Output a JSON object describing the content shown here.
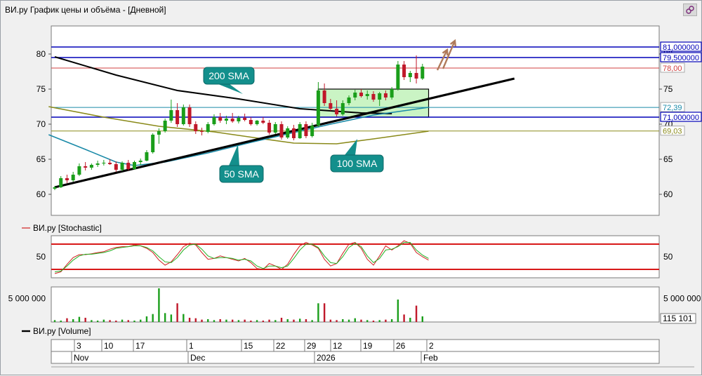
{
  "window": {
    "title": "ВИ.ру График цены и объёма - [Дневной]",
    "corner_icon": "link-icon"
  },
  "chart_data": [
    {
      "type": "candlestick",
      "panel": "price",
      "ylim": [
        57,
        84
      ],
      "y_ticks": [
        60,
        65,
        70,
        75,
        80
      ],
      "grid": false,
      "bar_count": 61,
      "series": [
        {
          "name": "candles",
          "color_up": "#1a9e1a",
          "color_down": "#c0182a",
          "ohlc": [
            [
              60.8,
              61.2,
              60.6,
              61.0
            ],
            [
              61.0,
              62.6,
              60.9,
              62.3
            ],
            [
              62.3,
              62.8,
              61.6,
              62.0
            ],
            [
              62.0,
              63.2,
              61.8,
              62.8
            ],
            [
              62.8,
              64.4,
              62.6,
              64.0
            ],
            [
              64.0,
              64.6,
              63.4,
              63.8
            ],
            [
              63.8,
              64.4,
              63.5,
              64.2
            ],
            [
              64.2,
              64.8,
              63.9,
              64.4
            ],
            [
              64.4,
              64.9,
              64.1,
              64.5
            ],
            [
              64.5,
              65.0,
              64.2,
              64.3
            ],
            [
              64.3,
              64.7,
              63.2,
              63.5
            ],
            [
              63.5,
              64.7,
              63.3,
              64.5
            ],
            [
              64.5,
              64.9,
              63.4,
              63.6
            ],
            [
              63.6,
              64.8,
              63.5,
              64.6
            ],
            [
              64.6,
              65.1,
              64.2,
              64.8
            ],
            [
              64.8,
              66.3,
              64.7,
              66.0
            ],
            [
              66.0,
              68.7,
              65.8,
              68.5
            ],
            [
              68.5,
              69.4,
              67.2,
              69.0
            ],
            [
              69.0,
              70.8,
              68.8,
              70.5
            ],
            [
              70.5,
              73.5,
              70.2,
              72.0
            ],
            [
              72.0,
              73.0,
              69.6,
              70.0
            ],
            [
              70.0,
              72.8,
              69.8,
              72.4
            ],
            [
              72.4,
              72.8,
              69.6,
              70.0
            ],
            [
              70.0,
              70.4,
              68.6,
              69.0
            ],
            [
              69.0,
              69.5,
              68.4,
              68.9
            ],
            [
              68.9,
              70.3,
              68.7,
              70.0
            ],
            [
              70.0,
              71.4,
              69.8,
              71.0
            ],
            [
              71.0,
              71.6,
              70.2,
              70.5
            ],
            [
              70.5,
              71.2,
              70.0,
              70.8
            ],
            [
              70.8,
              71.6,
              70.2,
              70.4
            ],
            [
              70.4,
              71.2,
              70.1,
              70.9
            ],
            [
              70.9,
              71.5,
              70.4,
              70.6
            ],
            [
              70.6,
              71.0,
              69.8,
              70.0
            ],
            [
              70.0,
              70.6,
              69.8,
              70.5
            ],
            [
              70.5,
              71.0,
              70.0,
              70.2
            ],
            [
              70.2,
              70.6,
              68.5,
              68.8
            ],
            [
              68.8,
              70.3,
              68.6,
              70.0
            ],
            [
              70.0,
              70.4,
              67.8,
              68.1
            ],
            [
              68.1,
              69.7,
              67.9,
              69.4
            ],
            [
              69.4,
              69.9,
              67.7,
              68.0
            ],
            [
              68.0,
              70.3,
              67.9,
              70.0
            ],
            [
              70.0,
              70.4,
              68.0,
              68.3
            ],
            [
              68.3,
              70.2,
              68.1,
              69.8
            ],
            [
              69.8,
              76.0,
              69.6,
              74.8
            ],
            [
              74.8,
              75.8,
              72.6,
              73.0
            ],
            [
              73.0,
              73.6,
              71.9,
              72.2
            ],
            [
              72.2,
              73.4,
              71.1,
              71.4
            ],
            [
              71.4,
              73.4,
              71.2,
              73.0
            ],
            [
              73.0,
              74.1,
              72.7,
              73.8
            ],
            [
              73.8,
              74.9,
              73.4,
              74.5
            ],
            [
              74.5,
              75.0,
              73.8,
              74.0
            ],
            [
              74.0,
              74.8,
              73.5,
              74.3
            ],
            [
              74.3,
              74.7,
              73.2,
              73.5
            ],
            [
              73.5,
              74.6,
              72.6,
              74.4
            ],
            [
              74.4,
              74.8,
              73.4,
              73.8
            ],
            [
              73.8,
              75.3,
              73.5,
              75.0
            ],
            [
              75.0,
              79.0,
              74.8,
              78.5
            ],
            [
              78.5,
              79.0,
              76.3,
              76.7
            ],
            [
              76.7,
              77.6,
              76.0,
              77.3
            ],
            [
              77.3,
              79.8,
              75.8,
              76.5
            ],
            [
              76.5,
              78.6,
              76.3,
              78.2
            ]
          ]
        },
        {
          "name": "200 SMA",
          "color": "#000000",
          "points": [
            [
              0,
              79.6
            ],
            [
              10,
              77.0
            ],
            [
              20,
              74.8
            ],
            [
              30,
              73.6
            ],
            [
              40,
              72.2
            ],
            [
              50,
              71.6
            ],
            [
              55,
              71.5
            ]
          ]
        },
        {
          "name": "100 SMA",
          "color": "#8a8a1a",
          "points": [
            [
              -1,
              72.5
            ],
            [
              8,
              71.0
            ],
            [
              17,
              69.7
            ],
            [
              26,
              68.9
            ],
            [
              34,
              67.9
            ],
            [
              39,
              67.3
            ],
            [
              46,
              67.2
            ],
            [
              52,
              67.9
            ],
            [
              61,
              69.0
            ]
          ]
        },
        {
          "name": "50 SMA",
          "color": "#1a8aa8",
          "points": [
            [
              -1,
              68.5
            ],
            [
              5,
              66.4
            ],
            [
              10,
              64.6
            ],
            [
              13,
              64.1
            ],
            [
              18,
              64.6
            ],
            [
              25,
              65.9
            ],
            [
              32,
              67.4
            ],
            [
              38,
              68.6
            ],
            [
              45,
              70.0
            ],
            [
              52,
              71.3
            ],
            [
              61,
              72.4
            ]
          ]
        }
      ],
      "hlines": [
        {
          "value": 81.0,
          "label": "81,000000",
          "color": "#0000b8",
          "style": "label-box"
        },
        {
          "value": 79.5,
          "label": "79,500000",
          "color": "#0000b8",
          "style": "label-box"
        },
        {
          "value": 78.0,
          "label": "78,00",
          "color": "#d04040",
          "style": "thin"
        },
        {
          "value": 72.39,
          "label": "72,39",
          "color": "#1a8aa8",
          "style": "thin"
        },
        {
          "value": 71.0,
          "label": "71,000000",
          "color": "#0000b8",
          "style": "label-box"
        },
        {
          "value": 69.03,
          "label": "69,03",
          "color": "#8a8a1a",
          "style": "thin"
        }
      ],
      "trendline": {
        "from": [
          0.0,
          61.0
        ],
        "to": [
          75.0,
          76.5
        ],
        "color": "#000000"
      },
      "annotations": [
        {
          "text": "200 SMA"
        },
        {
          "text": "50 SMA"
        },
        {
          "text": "100 SMA"
        }
      ],
      "box": {
        "x0": 43,
        "x1": 61,
        "y0": 71.0,
        "y1": 75.0,
        "fill": "#b8f0b0"
      }
    },
    {
      "type": "line",
      "panel": "stochastic",
      "title": "ВИ.ру [Stochastic]",
      "y_ticks": [
        50
      ],
      "levels": [
        80,
        20
      ],
      "series": [
        {
          "name": "%K",
          "color": "#d02020",
          "values": [
            10,
            14,
            32,
            48,
            55,
            55,
            57,
            60,
            62,
            68,
            72,
            74,
            74,
            78,
            76,
            70,
            60,
            42,
            30,
            38,
            55,
            74,
            82,
            78,
            60,
            44,
            46,
            52,
            48,
            44,
            40,
            46,
            36,
            22,
            20,
            34,
            28,
            20,
            32,
            56,
            76,
            84,
            78,
            70,
            44,
            28,
            34,
            58,
            80,
            84,
            70,
            44,
            30,
            52,
            76,
            66,
            76,
            88,
            82,
            60,
            50,
            42
          ]
        },
        {
          "name": "%D",
          "color": "#20b020",
          "values": [
            14,
            16,
            28,
            42,
            52,
            56,
            56,
            58,
            60,
            64,
            70,
            72,
            74,
            76,
            76,
            72,
            64,
            50,
            38,
            36,
            48,
            66,
            78,
            80,
            68,
            52,
            46,
            48,
            48,
            46,
            42,
            44,
            40,
            28,
            22,
            28,
            28,
            24,
            28,
            46,
            66,
            80,
            80,
            72,
            52,
            36,
            34,
            50,
            72,
            82,
            74,
            52,
            36,
            46,
            66,
            68,
            74,
            84,
            84,
            66,
            54,
            46
          ]
        }
      ]
    },
    {
      "type": "bar",
      "panel": "volume",
      "title": "ВИ.ру [Volume]",
      "y_ticks": [
        5000000
      ],
      "tick_label": "5 000 000",
      "last_value_label": "115 101",
      "values": [
        400000,
        300000,
        800000,
        600000,
        1100000,
        900000,
        400000,
        300000,
        500000,
        400000,
        300000,
        500000,
        400000,
        300000,
        500000,
        1200000,
        1700000,
        7200000,
        1900000,
        1600000,
        4000000,
        1700000,
        900000,
        800000,
        500000,
        600000,
        400000,
        600000,
        500000,
        500000,
        400000,
        500000,
        300000,
        400000,
        300000,
        500000,
        400000,
        900000,
        600000,
        500000,
        700000,
        600000,
        400000,
        4000000,
        4000000,
        500000,
        400000,
        600000,
        500000,
        800000,
        500000,
        400000,
        300000,
        400000,
        500000,
        600000,
        4800000,
        1600000,
        900000,
        3500000,
        1200000
      ]
    }
  ],
  "x_axis": {
    "days": [
      "3",
      "10",
      "17",
      "1",
      "15",
      "22",
      "29",
      "12",
      "19",
      "26",
      "2"
    ],
    "months": [
      "Nov",
      "Dec",
      "2026",
      "Feb"
    ]
  }
}
